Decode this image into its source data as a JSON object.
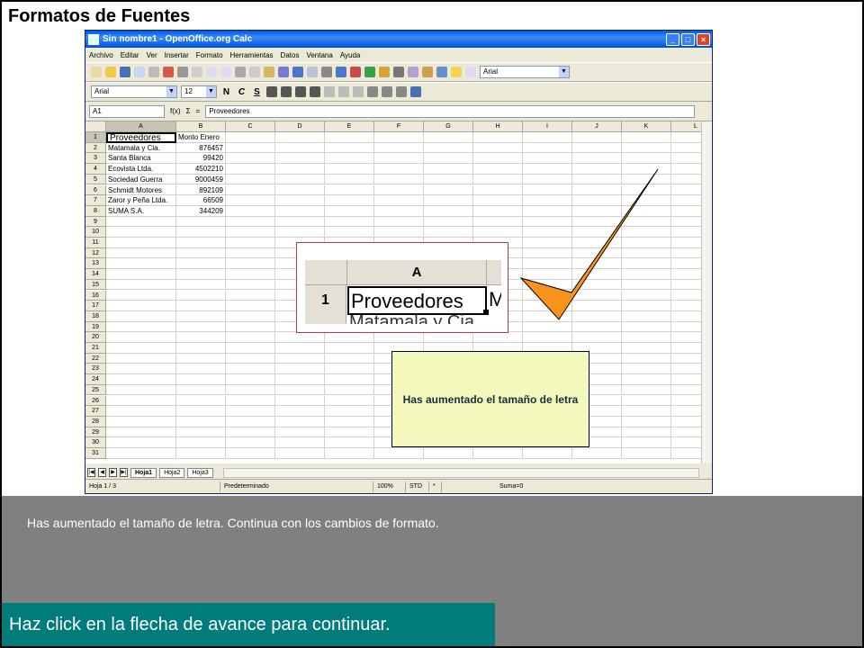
{
  "page": {
    "title": "Formatos de Fuentes"
  },
  "window": {
    "title": "Sin nombre1 - OpenOffice.org Calc"
  },
  "menu": [
    "Archivo",
    "Editar",
    "Ver",
    "Insertar",
    "Formato",
    "Herramientas",
    "Datos",
    "Ventana",
    "Ayuda"
  ],
  "toolbar": {
    "font_top": "Arial",
    "font_name": "Arial",
    "font_size": "12",
    "bold": "N",
    "italic": "C",
    "underline": "S"
  },
  "formula_bar": {
    "cell_ref": "A1",
    "content": "Proveedores"
  },
  "grid": {
    "columns": [
      "A",
      "B",
      "C",
      "D",
      "E",
      "F",
      "G",
      "H",
      "I",
      "J",
      "K",
      "L"
    ],
    "rows": [
      "1",
      "2",
      "3",
      "4",
      "5",
      "6",
      "7",
      "8",
      "9",
      "10",
      "11",
      "12",
      "13",
      "14",
      "15",
      "16",
      "17",
      "18",
      "19",
      "20",
      "21",
      "22",
      "23",
      "24",
      "25",
      "26",
      "27",
      "28",
      "29",
      "30",
      "31"
    ],
    "data": [
      [
        "Proveedores",
        "Monto Enero"
      ],
      [
        "Matamala y Cia.",
        "876457"
      ],
      [
        "Santa Blanca",
        "99420"
      ],
      [
        "Ecovista Ltda.",
        "4502210"
      ],
      [
        "Sociedad Guerra",
        "9000459"
      ],
      [
        "Schmidt Motores",
        "892109"
      ],
      [
        "Zaror y Peña Ltda.",
        "66509"
      ],
      [
        "SUMA S.A.",
        "344209"
      ]
    ]
  },
  "sheets": [
    "Hoja1",
    "Hoja2",
    "Hoja3"
  ],
  "status": {
    "sheet": "Hoja 1 / 3",
    "style": "Predeterminado",
    "zoom": "100%",
    "mode": "STD",
    "star": "*",
    "sum": "Suma=0"
  },
  "zoom_callout": {
    "col": "A",
    "row": "1",
    "cell": "Proveedores",
    "next": "M",
    "row2_text": "Matamala y Cia"
  },
  "message": "Has aumentado el tamaño de letra",
  "bottom_text": "Has aumentado el tamaño de letra. Continua con los cambios de formato.",
  "instruction": "Haz click en la flecha de avance para continuar.",
  "colors": {
    "checkmark": "#f7941d",
    "panel": "#808080",
    "instruction_bg": "#007c7c",
    "message_bg": "#f3f8bd"
  },
  "icons": [
    "checkmark-icon"
  ]
}
